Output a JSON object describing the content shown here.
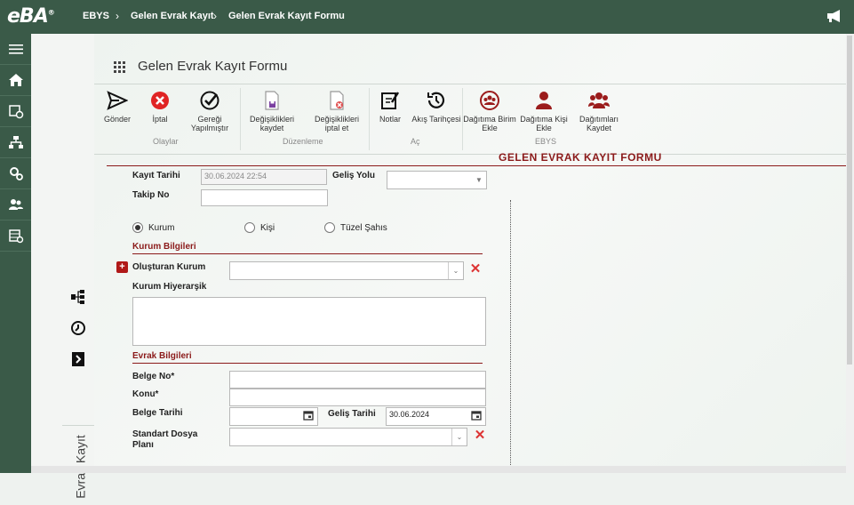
{
  "header": {
    "logo": "eBA",
    "breadcrumb": [
      "EBYS",
      "Gelen Evrak Kayıt",
      "Gelen Evrak Kayıt Formu"
    ]
  },
  "side_panel": {
    "title": "Evrak Kayıt"
  },
  "form": {
    "title": "Gelen Evrak Kayıt Formu",
    "banner": "GELEN EVRAK KAYIT FORMU"
  },
  "toolbar": {
    "buttons": {
      "gonder": "Gönder",
      "iptal": "İptal",
      "geregi": "Gereği Yapılmıştır",
      "degisiklikleri_kaydet": "Değişiklikleri kaydet",
      "degisiklikleri_iptal": "Değişiklikleri iptal et",
      "notlar": "Notlar",
      "akis": "Akış Tarihçesi",
      "dagitima_birim": "Dağıtıma Birim Ekle",
      "dagitima_kisi": "Dağıtıma Kişi Ekle",
      "dagitimlari_kaydet": "Dağıtımları Kaydet"
    },
    "groups": {
      "olaylar": "Olaylar",
      "duzenleme": "Düzenleme",
      "ac": "Aç",
      "ebys": "EBYS"
    }
  },
  "fields": {
    "kayit_tarihi_label": "Kayıt Tarihi",
    "kayit_tarihi_value": "30.06.2024 22:54",
    "gelis_yolu_label": "Geliş Yolu",
    "gelis_yolu_value": "",
    "takip_no_label": "Takip No",
    "takip_no_value": "",
    "radio_kurum": "Kurum",
    "radio_kisi": "Kişi",
    "radio_tuzel": "Tüzel Şahıs",
    "selected_radio": "Kurum",
    "section_kurum": "Kurum Bilgileri",
    "olusturan_kurum_label": "Oluşturan Kurum",
    "olusturan_kurum_value": "",
    "kurum_hiyerarsik_label": "Kurum Hiyerarşik",
    "section_evrak": "Evrak Bilgileri",
    "belge_no_label": "Belge No*",
    "konu_label": "Konu*",
    "belge_tarihi_label": "Belge Tarihi",
    "belge_tarihi_value": "",
    "gelis_tarihi_label": "Geliş Tarihi",
    "gelis_tarihi_value": "30.06.2024",
    "standart_dosya_label": "Standart Dosya Planı",
    "standart_dosya_value": ""
  },
  "colors": {
    "header_bg": "#3a5a48",
    "accent_red": "#8b1a1a",
    "delete_red": "#d33333"
  }
}
